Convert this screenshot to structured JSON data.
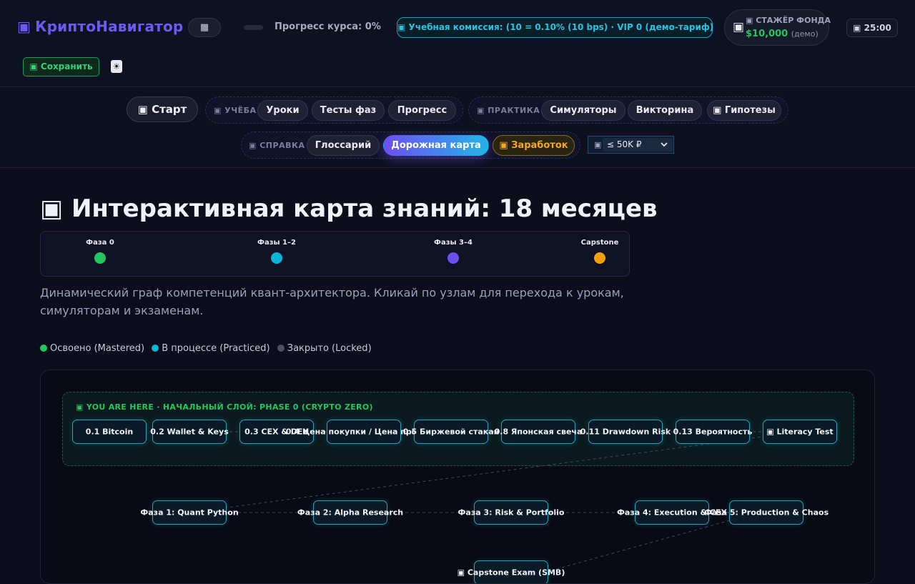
{
  "header": {
    "brand_icon": "▣",
    "brand": "КриптоНавигатор",
    "menu_icon": "▦",
    "progress_percent": 0,
    "progress_text": "Прогресс курса: 0%",
    "commission": "▣ Учебная комиссия: (10 = 0.10% (10 bps) · VIP 0 (демо-тариф)",
    "fund": {
      "icon": "▣",
      "title": "▣ СТАЖЁР ФОНДА",
      "amount": "$10,000",
      "demo": "(демо)"
    },
    "timer": "▣ 25:00",
    "save_button": "▣ Сохранить",
    "theme_icon": "☀"
  },
  "nav": {
    "start": "▣ Старт",
    "groups": [
      {
        "label": "▣ УЧЁБА",
        "tabs": [
          "Уроки",
          "Тесты фаз",
          "Прогресс"
        ]
      },
      {
        "label": "▣ ПРАКТИКА",
        "tabs": [
          "Симуляторы",
          "Викторина",
          "▣ Гипотезы"
        ]
      },
      {
        "label": "▣ СПРАВКА",
        "tabs": [
          "Глоссарий",
          "Дорожная карта",
          "▣ Заработок"
        ]
      }
    ],
    "active_tab": "Дорожная карта",
    "currency_icon": "▣",
    "currency_value": "≤ 50K ₽"
  },
  "main": {
    "title": "▣ Интерактивная карта знаний: 18 месяцев",
    "phases": [
      {
        "label": "Фаза 0",
        "color": "#22c55e"
      },
      {
        "label": "Фазы 1–2",
        "color": "#06b6d4"
      },
      {
        "label": "Фазы 3–4",
        "color": "#6d4ff0"
      },
      {
        "label": "Capstone",
        "color": "#f59e0b"
      }
    ],
    "intro": "Динамический граф компетенций квант-архитектора. Кликай по узлам для перехода к урокам, симуляторам и экзаменам.",
    "status_legend": [
      {
        "label": "Освоено (Mastered)",
        "color": "#22c55e"
      },
      {
        "label": "В процессе (Practiced)",
        "color": "#06b6d4"
      },
      {
        "label": "Закрыто (Locked)",
        "color": "#4b5066"
      }
    ],
    "graph": {
      "zone_label": "▣ YOU ARE HERE · НАЧАЛЬНЫЙ СЛОЙ: PHASE 0 (CRYPTO ZERO)",
      "phase0_nodes": [
        "0.1 Bitcoin",
        "0.2 Wallet & Keys",
        "0.3 CEX & DEX",
        "0.4 Цена покупки / Цена продажи",
        "0.5 Биржевой стакан",
        "0.8 Японская свеча",
        "0.11 Drawdown Risk",
        "0.13 Вероятность",
        "▣ Literacy Test"
      ],
      "phase_nodes": [
        "Фаза 1: Quant Python",
        "Фаза 2: Alpha Research",
        "Фаза 3: Risk & Portfolio",
        "Фаза 4: Execution & CEX",
        "Фаза 5: Production & Chaos"
      ],
      "capstone_node": "▣ Capstone Exam (SMB)"
    }
  }
}
